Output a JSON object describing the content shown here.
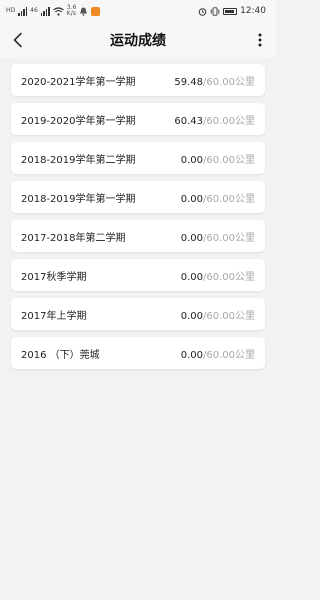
{
  "status_bar": {
    "left_labels": [
      "HD",
      "46",
      "4G",
      "3.6\nK/s"
    ],
    "time": "12:40",
    "accent": "#f08a24"
  },
  "header": {
    "title": "运动成绩",
    "back_icon": "chevron-left-icon",
    "more_icon": "more-vertical-icon"
  },
  "records": [
    {
      "term": "2020-2021学年第一学期",
      "done": "59.48",
      "sep": "/",
      "goal": "60.00",
      "unit": "公里"
    },
    {
      "term": "2019-2020学年第一学期",
      "done": "60.43",
      "sep": "/",
      "goal": "60.00",
      "unit": "公里"
    },
    {
      "term": "2018-2019学年第二学期",
      "done": "0.00",
      "sep": "/",
      "goal": "60.00",
      "unit": "公里"
    },
    {
      "term": "2018-2019学年第一学期",
      "done": "0.00",
      "sep": "/",
      "goal": "60.00",
      "unit": "公里"
    },
    {
      "term": "2017-2018年第二学期",
      "done": "0.00",
      "sep": "/",
      "goal": "60.00",
      "unit": "公里"
    },
    {
      "term": "2017秋季学期",
      "done": "0.00",
      "sep": "/",
      "goal": "60.00",
      "unit": "公里"
    },
    {
      "term": "2017年上学期",
      "done": "0.00",
      "sep": "/",
      "goal": "60.00",
      "unit": "公里"
    },
    {
      "term": "2016 （下）莞城",
      "done": "0.00",
      "sep": "/",
      "goal": "60.00",
      "unit": "公里"
    }
  ],
  "colors": {
    "background": "#f2f2f2",
    "card": "#ffffff",
    "muted": "#a8a8a8"
  }
}
